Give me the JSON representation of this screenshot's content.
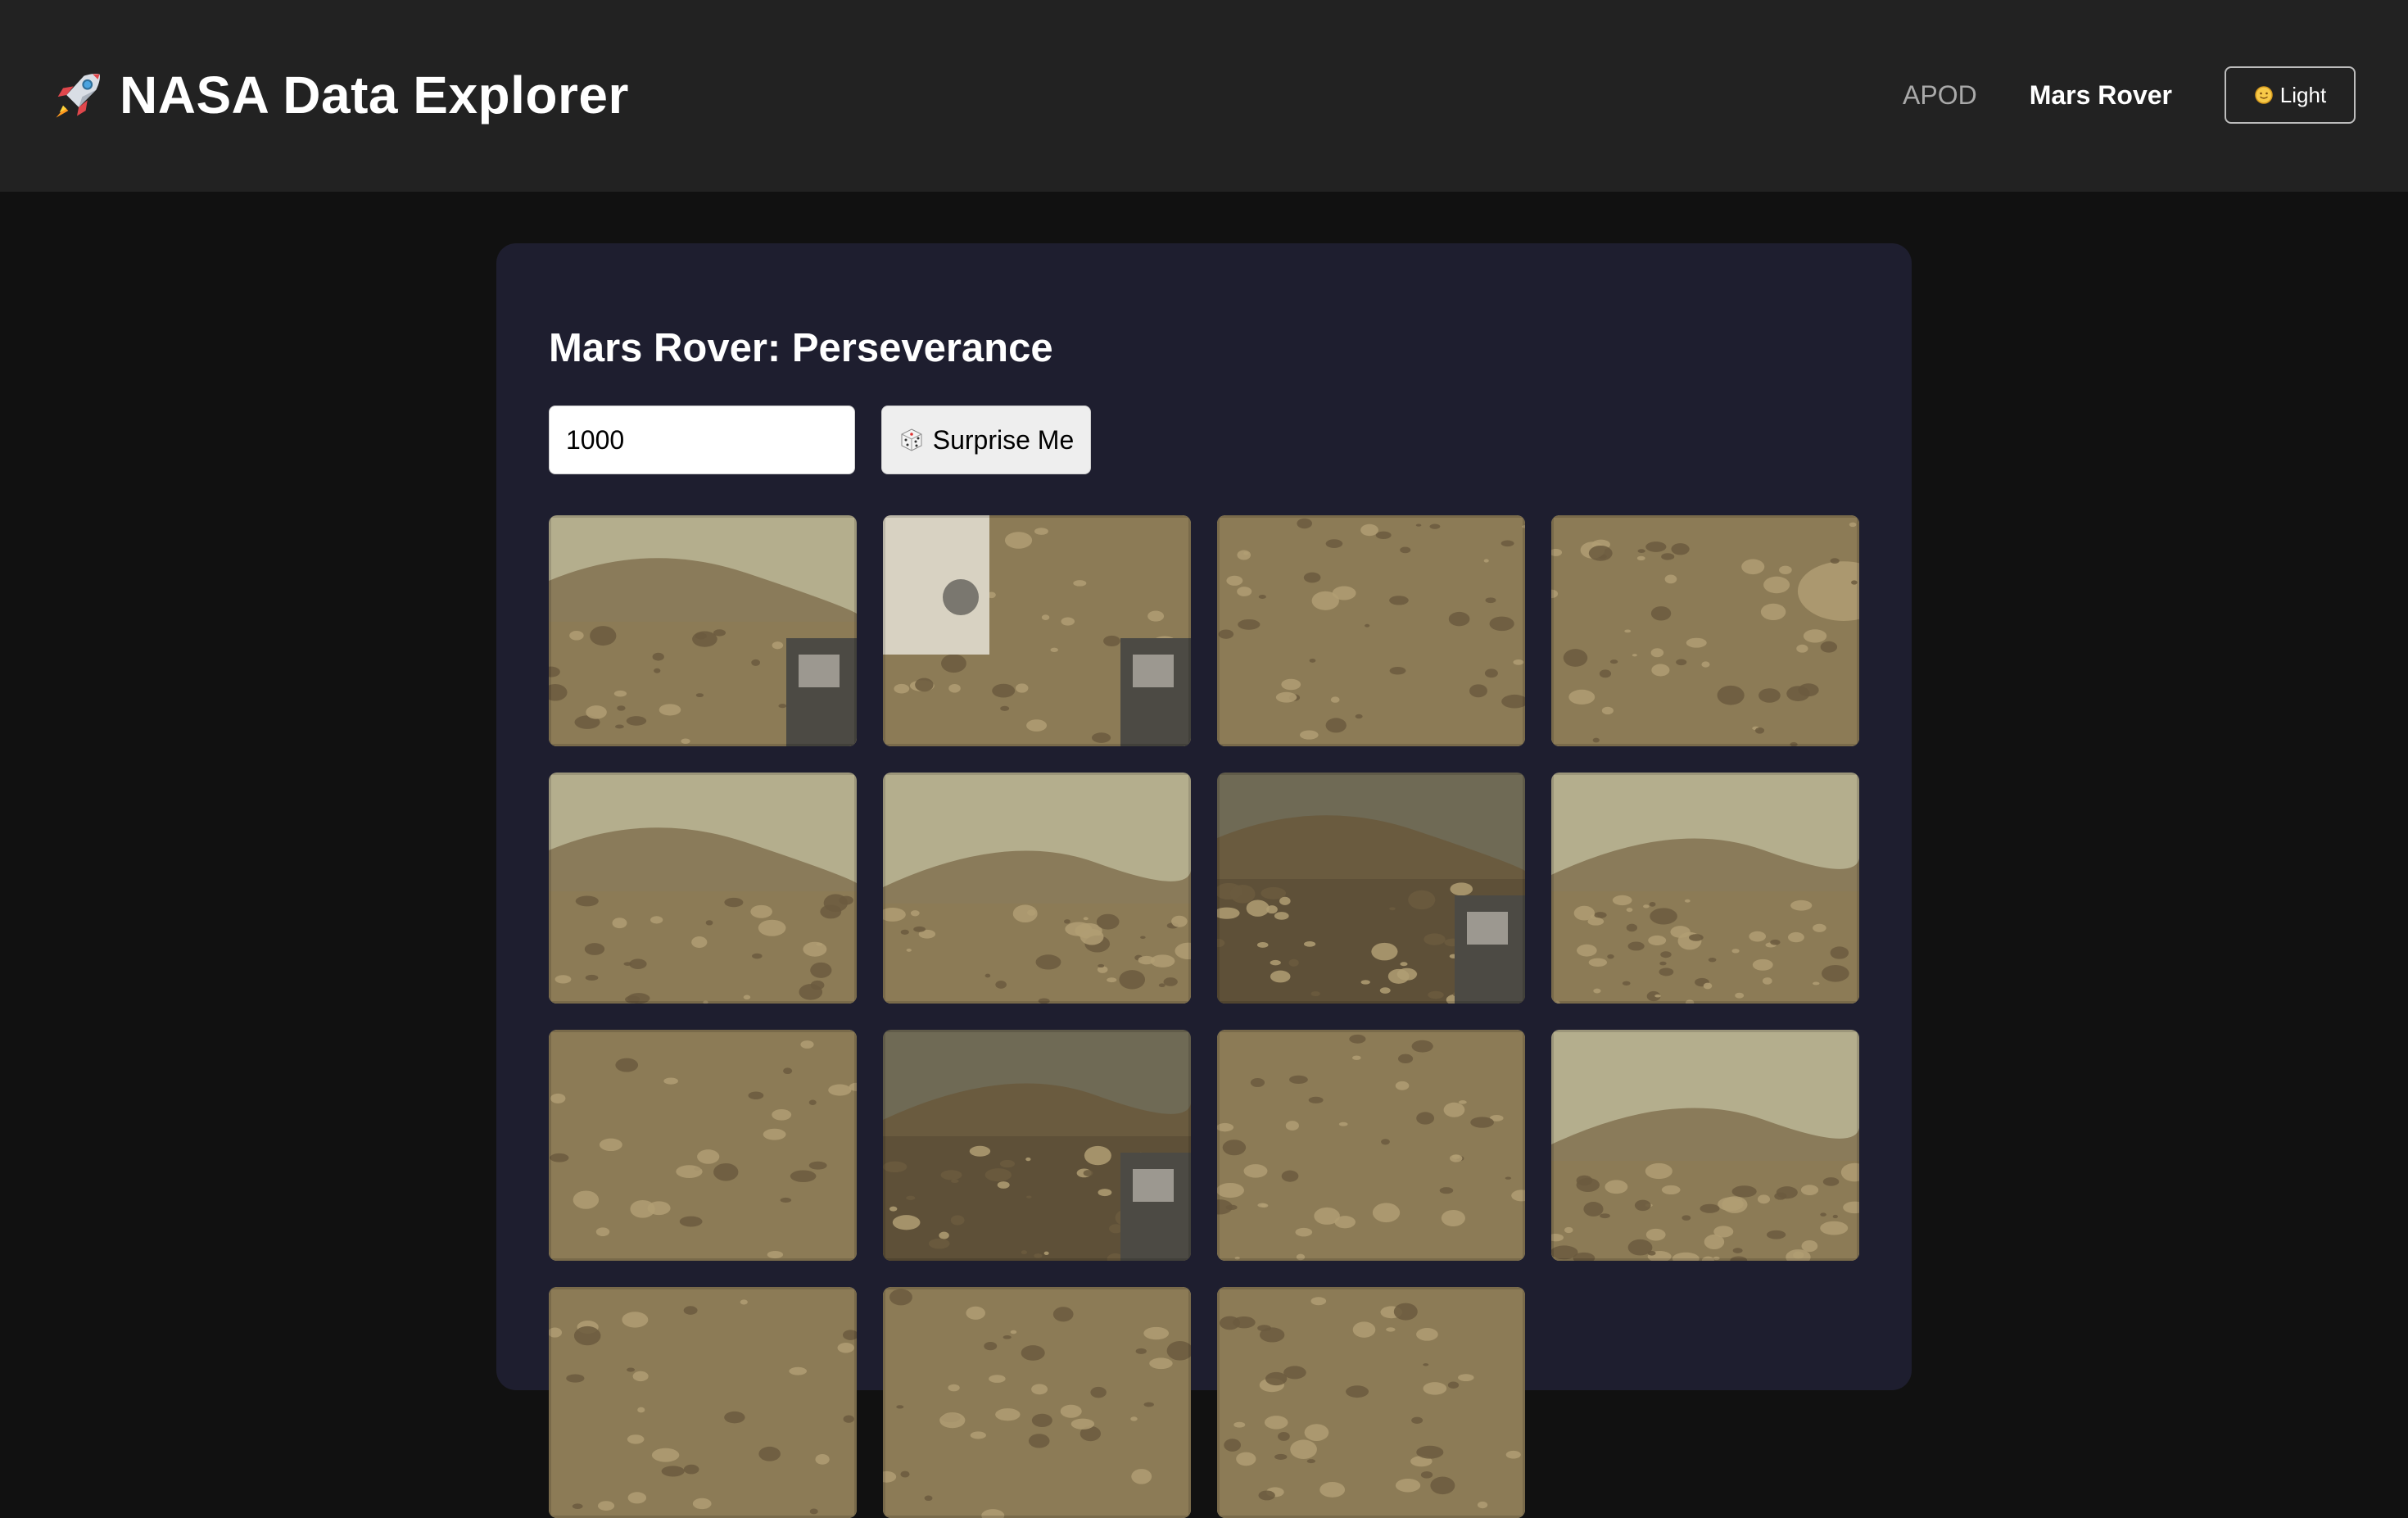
{
  "header": {
    "logo_icon": "rocket-icon",
    "title": "NASA Data Explorer",
    "nav": [
      {
        "label": "APOD",
        "active": false
      },
      {
        "label": "Mars Rover",
        "active": true
      }
    ],
    "theme_toggle": {
      "label": "Light",
      "icon": "sun-icon"
    }
  },
  "main": {
    "title": "Mars Rover: Perseverance",
    "sol_input": {
      "value": "1000"
    },
    "surprise_button": {
      "label": "Surprise Me",
      "icon": "dice-icon"
    },
    "photos": [
      {
        "scene": "horizon-left-rover-deck"
      },
      {
        "scene": "rover-arm-closeup"
      },
      {
        "scene": "rocky-ground"
      },
      {
        "scene": "rocky-ground-large-rock"
      },
      {
        "scene": "hill-slope"
      },
      {
        "scene": "hill-center"
      },
      {
        "scene": "hill-dark-rover-wheel"
      },
      {
        "scene": "hill-right"
      },
      {
        "scene": "rocky-ground"
      },
      {
        "scene": "dark-slope-rover-part"
      },
      {
        "scene": "rocky-field"
      },
      {
        "scene": "rocky-hill"
      },
      {
        "scene": "partial"
      },
      {
        "scene": "partial"
      },
      {
        "scene": "partial"
      }
    ]
  },
  "colors": {
    "page_bg": "#111111",
    "header_bg": "#222222",
    "panel_bg": "#1e1e2f",
    "nav_inactive": "#a9a9a9",
    "nav_active": "#ffffff",
    "mars_ground": "#8b7a57",
    "mars_sky": "#b5ae8c"
  }
}
